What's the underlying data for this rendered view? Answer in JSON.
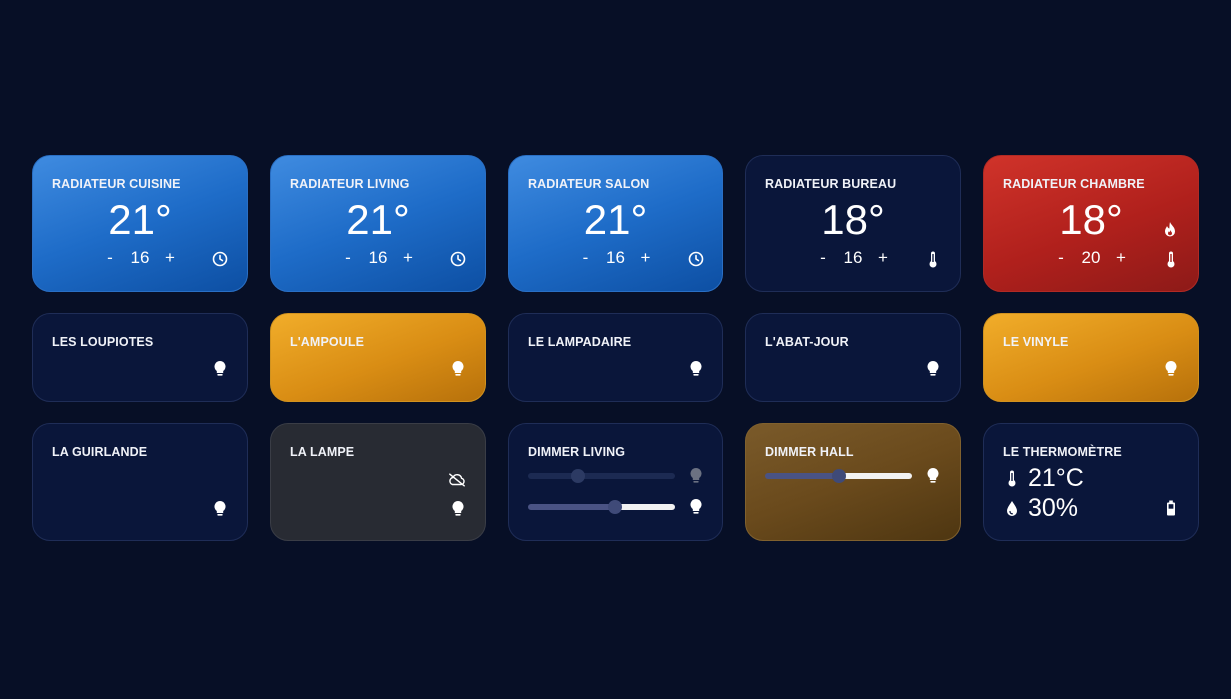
{
  "row1": [
    {
      "title": "RADIATEUR CUISINE",
      "temp": "21°",
      "minus": "-",
      "setpoint": "16",
      "plus": "+",
      "icon": "clock-icon"
    },
    {
      "title": "RADIATEUR LIVING",
      "temp": "21°",
      "minus": "-",
      "setpoint": "16",
      "plus": "+",
      "icon": "clock-icon"
    },
    {
      "title": "RADIATEUR SALON",
      "temp": "21°",
      "minus": "-",
      "setpoint": "16",
      "plus": "+",
      "icon": "clock-icon"
    },
    {
      "title": "RADIATEUR BUREAU",
      "temp": "18°",
      "minus": "-",
      "setpoint": "16",
      "plus": "+",
      "icon": "thermometer-icon"
    },
    {
      "title": "RADIATEUR CHAMBRE",
      "temp": "18°",
      "minus": "-",
      "setpoint": "20",
      "plus": "+",
      "icon": "thermometer-icon",
      "status_icon": "flame-icon"
    }
  ],
  "row2": [
    {
      "title": "LES LOUPIOTES",
      "state": "off",
      "icon": "lightbulb-icon"
    },
    {
      "title": "L'AMPOULE",
      "state": "on",
      "icon": "lightbulb-icon"
    },
    {
      "title": "LE LAMPADAIRE",
      "state": "off",
      "icon": "lightbulb-icon"
    },
    {
      "title": "L'ABAT-JOUR",
      "state": "off",
      "icon": "lightbulb-icon"
    },
    {
      "title": "LE VINYLE",
      "state": "on",
      "icon": "lightbulb-icon"
    }
  ],
  "row3": {
    "guirlande": {
      "title": "LA GUIRLANDE",
      "icon": "lightbulb-icon"
    },
    "lampe": {
      "title": "LA LAMPE",
      "status_icon": "cloud-off-icon",
      "icon": "lightbulb-icon",
      "state": "unavailable"
    },
    "dimmer_living": {
      "title": "DIMMER LIVING",
      "sliders": [
        {
          "level": 0.32,
          "state": "off"
        },
        {
          "level": 0.6,
          "state": "on"
        }
      ]
    },
    "dimmer_hall": {
      "title": "DIMMER HALL",
      "level": 0.5
    },
    "thermometre": {
      "title": "LE THERMOMÈTRE",
      "temperature": "21°C",
      "humidity": "30%",
      "icons": [
        "thermometer-icon",
        "water-drop-icon",
        "battery-icon"
      ]
    }
  },
  "colors": {
    "background": "#070f26",
    "card_dark": "#0a163a",
    "heating_blue": "#1e6cc8",
    "heating_red": "#b0201c",
    "light_on_amber": "#d98d14",
    "unavailable_gray": "#282b33",
    "dimmer_brown": "#6a4a1c"
  }
}
